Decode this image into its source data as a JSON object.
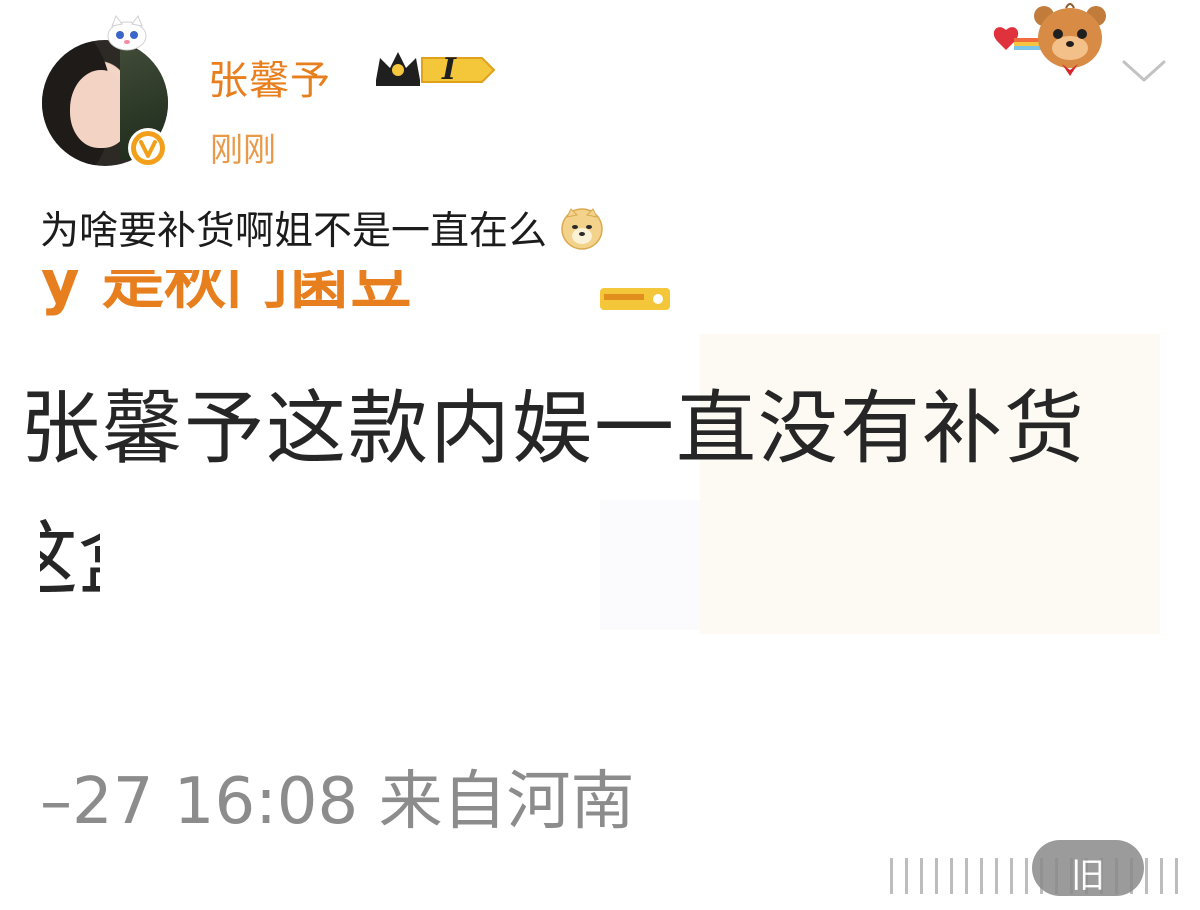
{
  "header": {
    "username": "张馨予",
    "badge_level": "I",
    "timestamp": "刚刚"
  },
  "post": {
    "text": "为啥要补货啊姐不是一直在么"
  },
  "quoted_image": {
    "cut_line": "y 是秋门菌豆",
    "title_line1": "张馨予这款内娱一直没有补货",
    "title_line2": "这盒",
    "meta": "–27 16:08 来自河南"
  },
  "watermark": {
    "label": "旧"
  },
  "colors": {
    "username": "#e87f1e",
    "timestamp": "#e89a4a",
    "verified_badge": "#f2a01a"
  },
  "icons": {
    "expand": "chevron-down-icon",
    "verified": "verified-v-icon",
    "doge": "doge-emoji-icon"
  }
}
